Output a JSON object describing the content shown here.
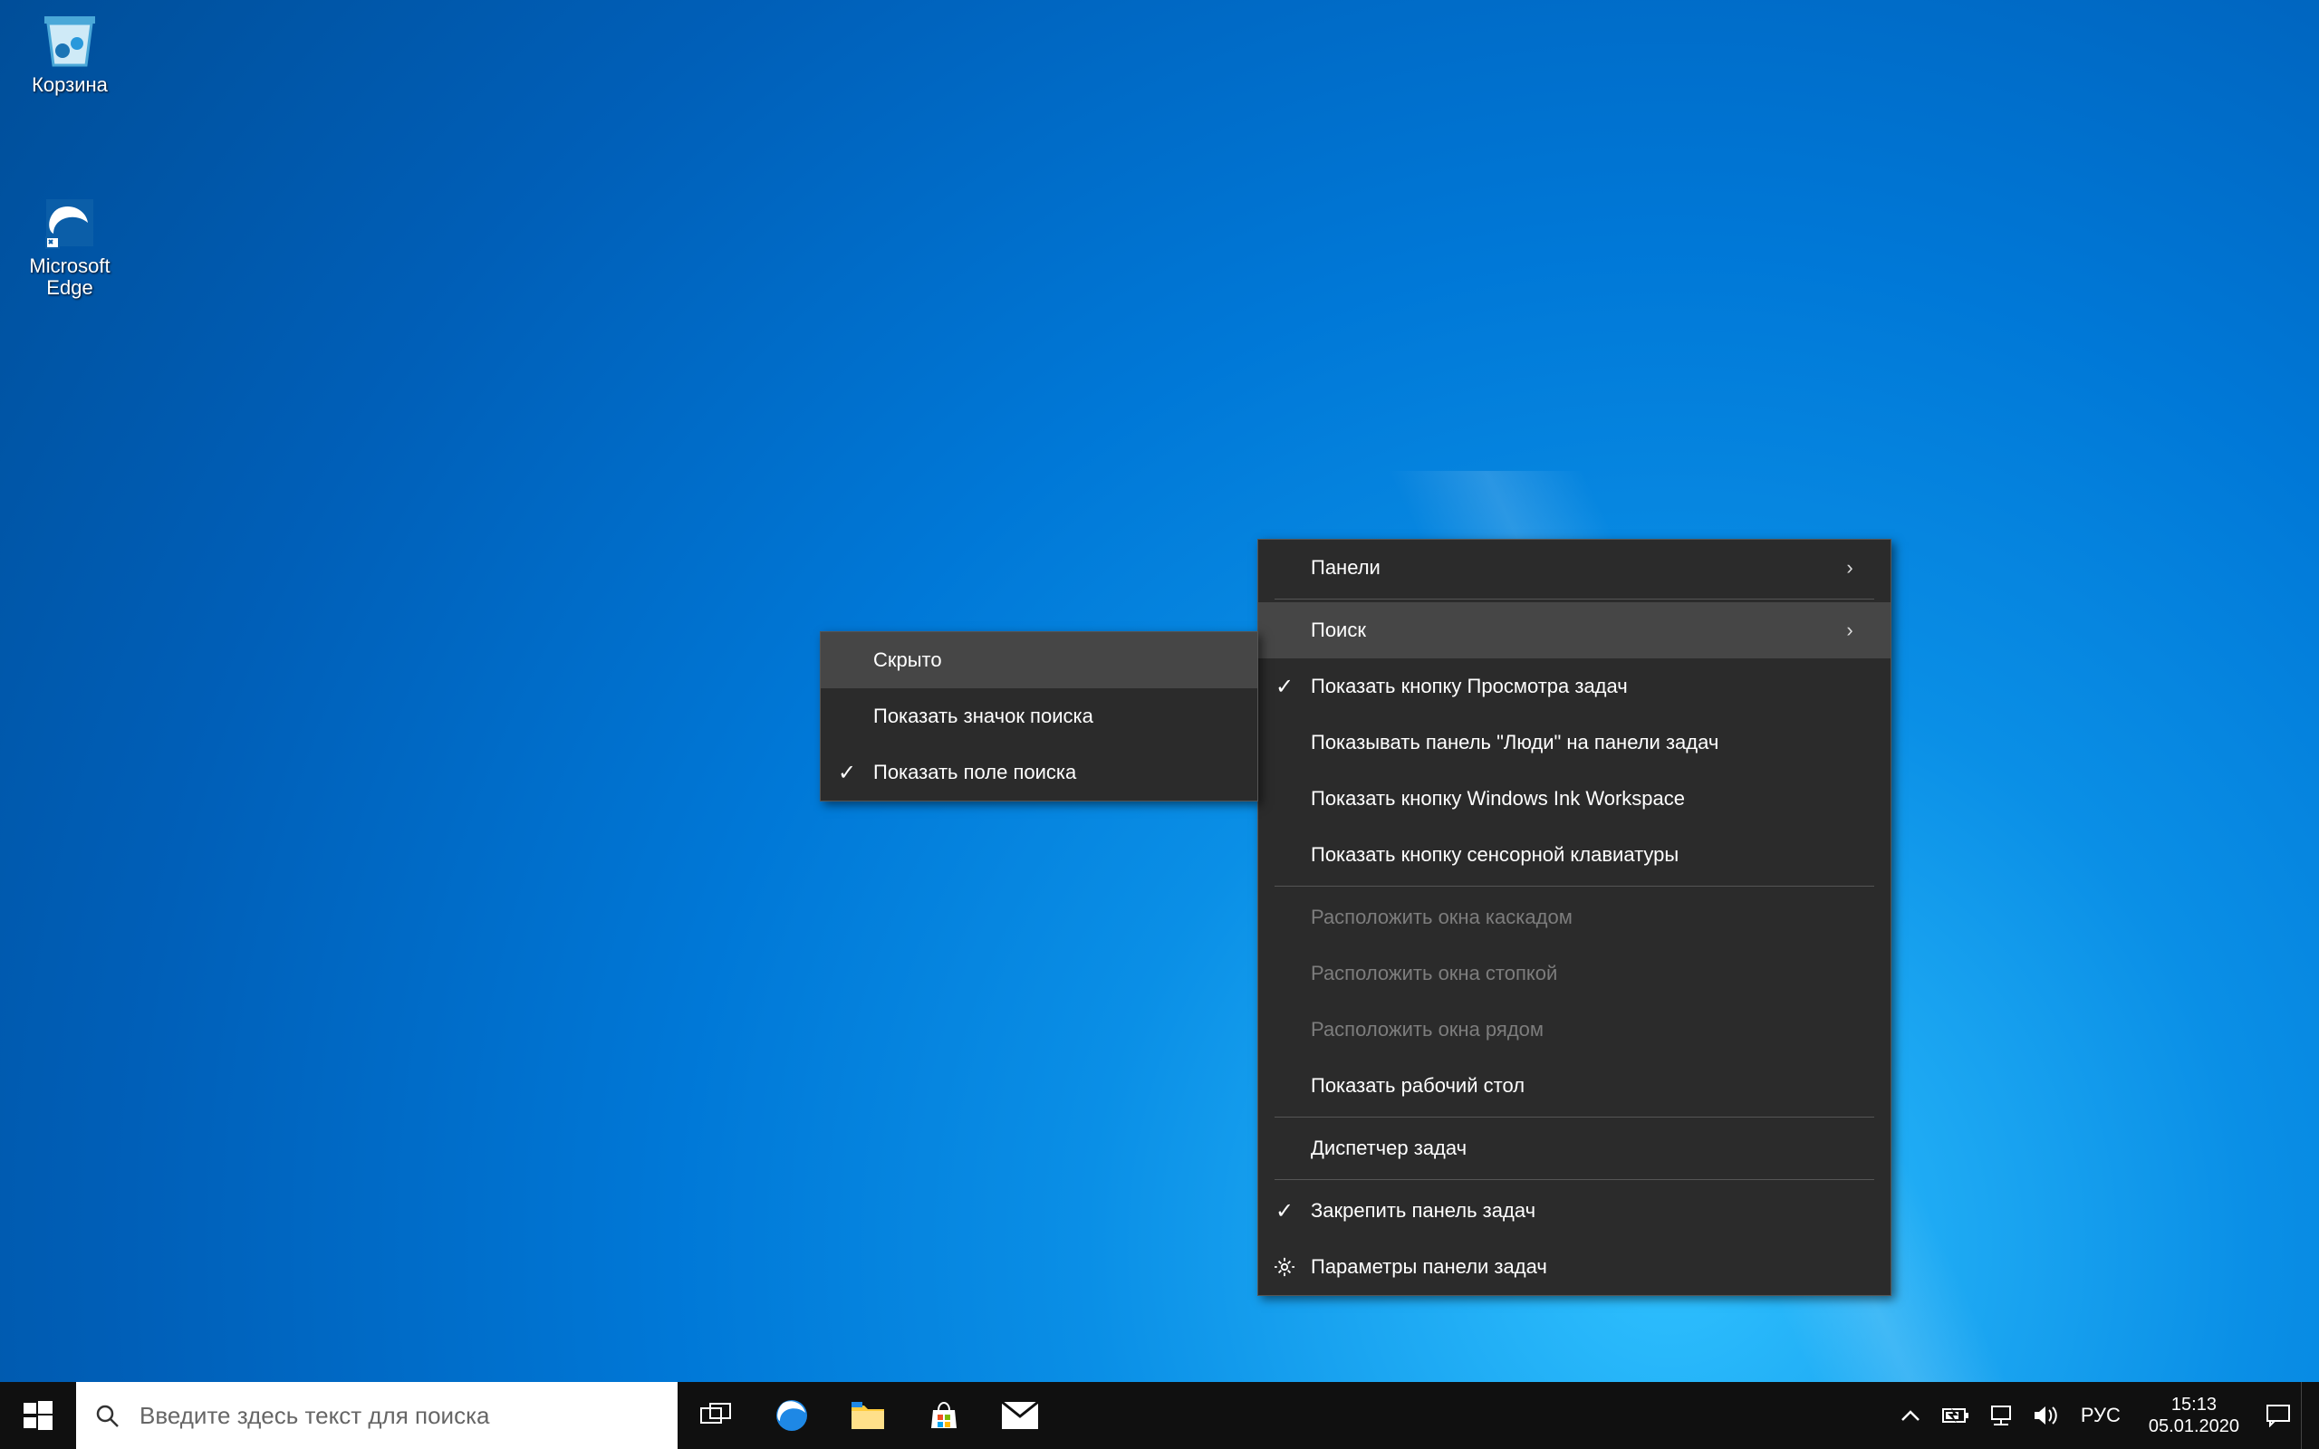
{
  "desktop": {
    "icons": [
      {
        "name": "recycle-bin",
        "label": "Корзина"
      },
      {
        "name": "edge",
        "label": "Microsoft Edge"
      }
    ]
  },
  "context_menu": {
    "items": [
      {
        "label": "Панели",
        "submenu": true
      },
      {
        "label": "Поиск",
        "submenu": true,
        "hover": true
      },
      {
        "label": "Показать кнопку Просмотра задач",
        "checked": true
      },
      {
        "label": "Показывать панель \"Люди\" на панели задач"
      },
      {
        "label": "Показать кнопку Windows Ink Workspace"
      },
      {
        "label": "Показать кнопку сенсорной клавиатуры"
      },
      {
        "sep": true
      },
      {
        "label": "Расположить окна каскадом",
        "disabled": true
      },
      {
        "label": "Расположить окна стопкой",
        "disabled": true
      },
      {
        "label": "Расположить окна рядом",
        "disabled": true
      },
      {
        "label": "Показать рабочий стол"
      },
      {
        "sep": true
      },
      {
        "label": "Диспетчер задач"
      },
      {
        "sep": true
      },
      {
        "label": "Закрепить панель задач",
        "checked": true
      },
      {
        "label": "Параметры панели задач",
        "icon": "gear"
      }
    ]
  },
  "submenu": {
    "items": [
      {
        "label": "Скрыто",
        "hover": true
      },
      {
        "label": "Показать значок поиска"
      },
      {
        "label": "Показать поле поиска",
        "checked": true
      }
    ]
  },
  "taskbar": {
    "search_placeholder": "Введите здесь текст для поиска",
    "pinned": [
      "edge",
      "explorer",
      "store",
      "mail"
    ]
  },
  "tray": {
    "lang": "РУС",
    "time": "15:13",
    "date": "05.01.2020"
  }
}
